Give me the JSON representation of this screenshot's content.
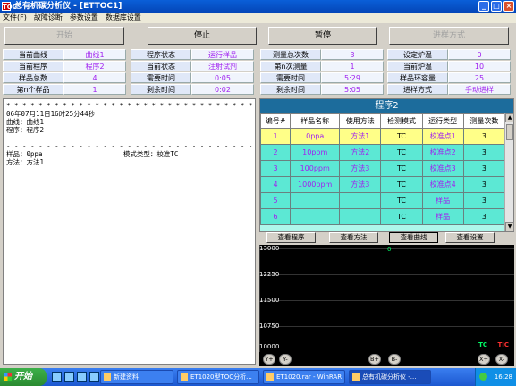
{
  "window": {
    "title": "总有机碳分析仪 - [ETTOC1]",
    "app_icon": "TOC"
  },
  "menu": [
    "文件(F)",
    "故障诊断",
    "参数设置",
    "数据库设置"
  ],
  "toolbar": {
    "start": "开始",
    "stop": "停止",
    "pause": "暂停",
    "mode": "进样方式"
  },
  "status": {
    "col1": [
      {
        "label": "当前曲线",
        "value": "曲线1"
      },
      {
        "label": "当前程序",
        "value": "程序2"
      },
      {
        "label": "样品总数",
        "value": "4"
      },
      {
        "label": "第n个样品",
        "value": "1"
      }
    ],
    "col2": [
      {
        "label": "程序状态",
        "value": "运行样品"
      },
      {
        "label": "当前状态",
        "value": "注射试剂"
      },
      {
        "label": "需要时间",
        "value": "0:05"
      },
      {
        "label": "剩余时间",
        "value": "0:02"
      }
    ],
    "col3": [
      {
        "label": "测量总次数",
        "value": "3"
      },
      {
        "label": "第n次测量",
        "value": "1"
      },
      {
        "label": "需要时间",
        "value": "5:29"
      },
      {
        "label": "剩余时间",
        "value": "5:05"
      }
    ],
    "col4": [
      {
        "label": "设定炉温",
        "value": "0"
      },
      {
        "label": "当前炉温",
        "value": "10"
      },
      {
        "label": "样品环容量",
        "value": "25"
      },
      {
        "label": "进样方式",
        "value": "手动进样"
      }
    ]
  },
  "report": {
    "stars": "* * * * * * * * * * * * * * * * * * * * * * * * * * * * * * * * * * *",
    "date": "06年07月11日16时25分44秒",
    "curve": "曲线：曲线1",
    "program": "程序：程序2",
    "dashes": "- - - - - - - - - - - - - - - - - - - - - - - - - - - - - - - - - - -",
    "sample": "样品：0ppa                    模式类型：校准TC",
    "method": "方法：方法1"
  },
  "program_table": {
    "title": "程序2",
    "headers": [
      "编号#",
      "样品名称",
      "使用方法",
      "检测模式",
      "运行类型",
      "测量次数"
    ],
    "rows": [
      [
        "1",
        "0ppa",
        "方法1",
        "TC",
        "校准点1",
        "3"
      ],
      [
        "2",
        "10ppm",
        "方法2",
        "TC",
        "校准点2",
        "3"
      ],
      [
        "3",
        "100ppm",
        "方法3",
        "TC",
        "校准点3",
        "3"
      ],
      [
        "4",
        "1000ppm",
        "方法3",
        "TC",
        "校准点4",
        "3"
      ],
      [
        "5",
        "",
        "",
        "TC",
        "样品",
        "3"
      ],
      [
        "6",
        "",
        "",
        "TC",
        "样品",
        "3"
      ]
    ]
  },
  "view_buttons": [
    "查看程序",
    "查看方法",
    "查看曲线",
    "查看设置"
  ],
  "chart": {
    "yticks": [
      "13000",
      "12250",
      "11500",
      "10750",
      "10000"
    ],
    "top_marker": "0",
    "legend1": "TC",
    "legend2": "TIC",
    "colors": {
      "tc": "#00ff66",
      "tic": "#ff3030"
    }
  },
  "zoom": {
    "y_plus": "Y+",
    "y_minus": "Y-",
    "b_plus": "B+",
    "b_minus": "B-",
    "x_plus": "X+",
    "x_minus": "X-"
  },
  "taskbar": {
    "start": "开始",
    "tasks": [
      "新建资料",
      "ET1020型TOC分析...",
      "ET1020.rar - WinRAR",
      "总有机碳分析仪 -..."
    ],
    "clock": "16:28"
  }
}
